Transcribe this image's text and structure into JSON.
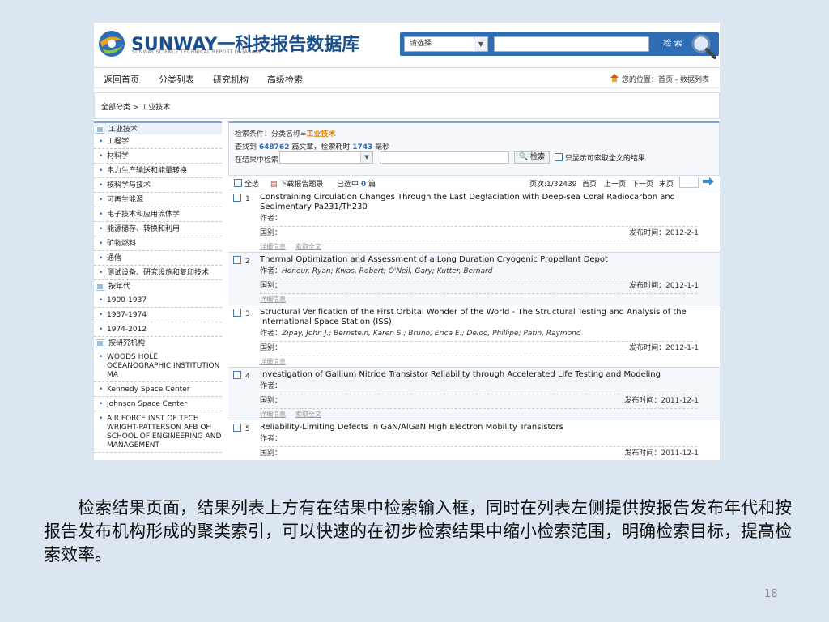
{
  "header": {
    "brand": "SUNWAY一科技报告数据库",
    "brand_sub": "SUNWAY SCIENCE TECHNICAL REPORT DATABASE",
    "select_value": "请选择",
    "search_button": "检 索"
  },
  "nav": {
    "items": [
      "返回首页",
      "分类列表",
      "研究机构",
      "高级检索"
    ],
    "location": "您的位置：首页 - 数据列表"
  },
  "breadcrumb": "全部分类 > 工业技术",
  "sidebar": {
    "category_title": "工业技术",
    "categories": [
      "工程学",
      "材料学",
      "电力生产输送和能量转换",
      "核科学与技术",
      "可再生能源",
      "电子技术和应用流体学",
      "能源储存、转换和利用",
      "矿物燃料",
      "通信",
      "测试设备、研究设施和复印技术"
    ],
    "year_title": "按年代",
    "years": [
      "1900-1937",
      "1937-1974",
      "1974-2012"
    ],
    "org_title": "按研究机构",
    "orgs": [
      "WOODS HOLE OCEANOGRAPHIC INSTITUTION MA",
      "Kennedy Space Center",
      "Johnson Space Center",
      "AIR FORCE INST OF TECH WRIGHT-PATTERSON AFB OH SCHOOL OF ENGINEERING AND MANAGEMENT"
    ]
  },
  "conditions": {
    "label": "检索条件：分类名称=",
    "category": "工业技术",
    "found_prefix": "查找到",
    "count": "648762",
    "found_mid": "篇文章，检索耗时",
    "time": "1743",
    "time_unit": "毫秒",
    "within_label": "在结果中检索：",
    "search_btn": "检索",
    "fulltext_only": "只显示可索取全文的结果"
  },
  "toolbar": {
    "select_all": "全选",
    "download": "下载报告题录",
    "selected_prefix": "已选中",
    "selected_count": "0",
    "selected_unit": "篇",
    "page_info": "页次:1/32439",
    "first": "首页",
    "prev": "上一页",
    "next": "下一页",
    "last": "末页"
  },
  "results": [
    {
      "num": "1",
      "title": "Constraining Circulation Changes Through the Last Deglaciation with Deep-sea Coral Radiocarbon and Sedimentary Pa231/Th230",
      "author_label": "作者：",
      "authors": "",
      "country_label": "国别：",
      "pub_label": "发布时间：",
      "date": "2012-2-1",
      "links": [
        "详细信息",
        "索取全文"
      ]
    },
    {
      "num": "2",
      "title": "Thermal Optimization and Assessment of a Long Duration Cryogenic Propellant Depot",
      "author_label": "作者：",
      "authors": "Honour, Ryan; Kwas, Robert; O'Neil, Gary; Kutter, Bernard",
      "country_label": "国别：",
      "pub_label": "发布时间：",
      "date": "2012-1-1",
      "links": [
        "详细信息"
      ]
    },
    {
      "num": "3",
      "title": "Structural Verification of the First Orbital Wonder of the World - The Structural Testing and Analysis of the International Space Station (ISS)",
      "author_label": "作者：",
      "authors": "Zipay, John J.; Bernstein, Karen S.; Bruno, Erica E.; Deloo, Phillipe; Patin, Raymond",
      "country_label": "国别：",
      "pub_label": "发布时间：",
      "date": "2012-1-1",
      "links": [
        "详细信息"
      ]
    },
    {
      "num": "4",
      "title": "Investigation of Gallium Nitride Transistor Reliability through Accelerated Life Testing and Modeling",
      "author_label": "作者：",
      "authors": "",
      "country_label": "国别：",
      "pub_label": "发布时间：",
      "date": "2011-12-1",
      "links": [
        "详细信息",
        "索取全文"
      ]
    },
    {
      "num": "5",
      "title": "Reliability-Limiting Defects in GaN/AlGaN High Electron Mobility Transistors",
      "author_label": "作者：",
      "authors": "",
      "country_label": "国别：",
      "pub_label": "发布时间：",
      "date": "2011-12-1",
      "links": []
    }
  ],
  "caption": "检索结果页面，结果列表上方有在结果中检索输入框，同时在列表左侧提供按报告发布年代和按报告发布机构形成的聚类索引，可以快速的在初步检索结果中缩小检索范围，明确检索目标，提高检索效率。",
  "page_number": "18",
  "colors": {
    "accent": "#2e6cb5",
    "highlight": "#e07a00",
    "background": "#dbe6f1"
  }
}
